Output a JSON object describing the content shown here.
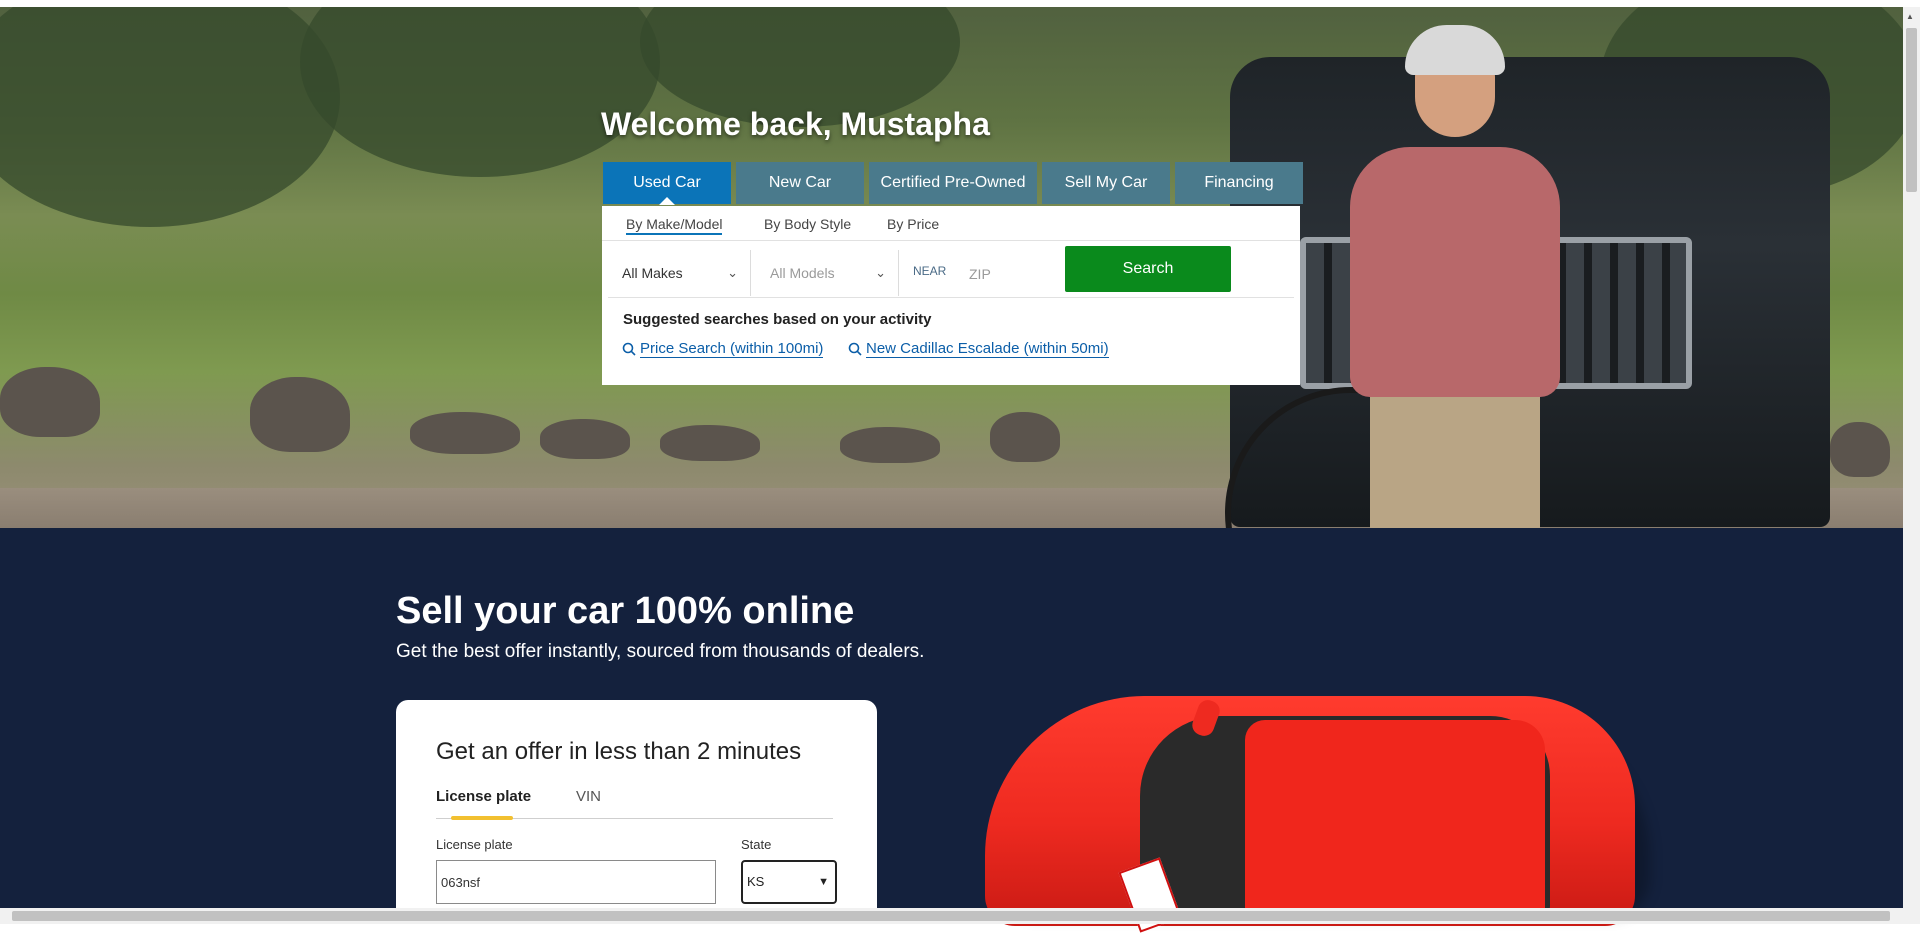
{
  "hero": {
    "welcome": "Welcome back, Mustapha",
    "tabs": [
      {
        "label": "Used Car",
        "active": true
      },
      {
        "label": "New Car",
        "active": false
      },
      {
        "label": "Certified Pre-Owned",
        "active": false
      },
      {
        "label": "Sell My Car",
        "active": false
      },
      {
        "label": "Financing",
        "active": false
      }
    ],
    "subtabs": [
      {
        "label": "By Make/Model",
        "active": true
      },
      {
        "label": "By Body Style",
        "active": false
      },
      {
        "label": "By Price",
        "active": false
      }
    ],
    "make_select": "All Makes",
    "model_select": "All Models",
    "near_label": "NEAR",
    "zip_placeholder": "ZIP",
    "search_button": "Search",
    "suggested_title": "Suggested searches based on your activity",
    "suggestions": [
      {
        "label": "Price Search (within 100mi)",
        "icon": "search-icon"
      },
      {
        "label": "New Cadillac Escalade (within 50mi)",
        "icon": "search-icon"
      }
    ]
  },
  "sell": {
    "title": "Sell your car 100% online",
    "subtitle": "Get the best offer instantly, sourced from thousands of dealers.",
    "card": {
      "title": "Get an offer in less than 2 minutes",
      "tabs": [
        {
          "label": "License plate",
          "active": true
        },
        {
          "label": "VIN",
          "active": false
        }
      ],
      "plate_label": "License plate",
      "plate_value": "063nsf",
      "state_label": "State",
      "state_value": "KS"
    }
  },
  "colors": {
    "accent_blue": "#0b74b8",
    "tab_teal": "#4a7a8c",
    "search_green": "#0a8a1c",
    "navy": "#14213d",
    "tab_indicator": "#f2c030"
  }
}
